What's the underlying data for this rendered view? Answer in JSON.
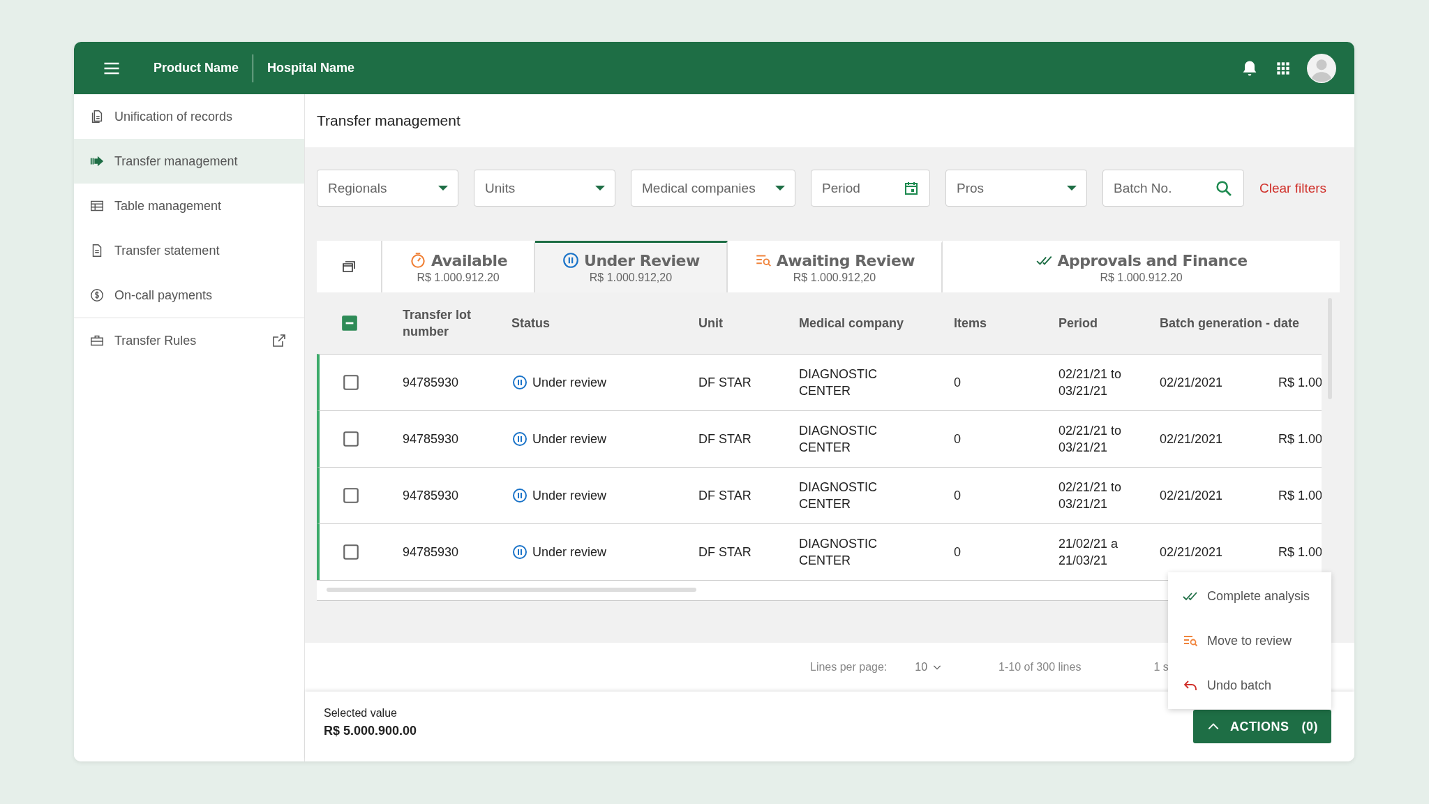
{
  "header": {
    "product": "Product Name",
    "hospital": "Hospital Name"
  },
  "sidebar": {
    "items": [
      {
        "label": "Unification of records",
        "kind": "documents",
        "selected": false
      },
      {
        "label": "Transfer management",
        "kind": "transfer",
        "selected": true
      },
      {
        "label": "Table management",
        "kind": "table",
        "selected": false
      },
      {
        "label": "Transfer statement",
        "kind": "document",
        "selected": false
      },
      {
        "label": "On-call payments",
        "kind": "money",
        "selected": false
      },
      {
        "label": "Transfer Rules",
        "kind": "briefcase",
        "selected": false,
        "external": true
      }
    ]
  },
  "page_title": "Transfer management",
  "filters": [
    {
      "kind": "dropdown",
      "placeholder": "Regionals"
    },
    {
      "kind": "dropdown",
      "placeholder": "Units"
    },
    {
      "kind": "dropdown",
      "placeholder": "Medical companies"
    },
    {
      "kind": "date",
      "placeholder": "Period"
    },
    {
      "kind": "dropdown",
      "placeholder": "Pros"
    },
    {
      "kind": "search",
      "placeholder": "Batch No."
    }
  ],
  "clear_filters": "Clear filters",
  "tabs": [
    {
      "label": "Available",
      "amount": "R$ 1.000.912.20",
      "kind": "timer",
      "selected": false
    },
    {
      "label": "Under Review",
      "amount": "R$ 1.000.912,20",
      "kind": "pause",
      "selected": true
    },
    {
      "label": "Awaiting Review",
      "amount": "R$ 1.000.912,20",
      "kind": "review",
      "selected": false
    },
    {
      "label": "Approvals and Finance",
      "amount": "R$ 1.000.912.20",
      "kind": "check",
      "selected": false
    }
  ],
  "table": {
    "select_all": {
      "indeterminate": true
    },
    "columns": [
      "Transfer lot number",
      "Status",
      "Unit",
      "Medical company",
      "Items",
      "Period",
      "Batch generation - date"
    ],
    "rows": [
      {
        "checked": false,
        "lot": "94785930",
        "status": "Under review",
        "unit": "DF STAR",
        "company": "DIAGNOSTIC CENTER",
        "items": "0",
        "period": "02/21/21 to 03/21/21",
        "date": "02/21/2021",
        "column_8": "R$ 1.00"
      },
      {
        "checked": false,
        "lot": "94785930",
        "status": "Under review",
        "unit": "DF STAR",
        "company": "DIAGNOSTIC CENTER",
        "items": "0",
        "period": "02/21/21 to 03/21/21",
        "date": "02/21/2021",
        "column_8": "R$ 1.00"
      },
      {
        "checked": false,
        "lot": "94785930",
        "status": "Under review",
        "unit": "DF STAR",
        "company": "DIAGNOSTIC CENTER",
        "items": "0",
        "period": "02/21/21 to 03/21/21",
        "date": "02/21/2021",
        "column_8": "R$ 1.00"
      },
      {
        "checked": false,
        "lot": "94785930",
        "status": "Under review",
        "unit": "DF STAR",
        "company": "DIAGNOSTIC CENTER",
        "items": "0",
        "period": "21/02/21 a 21/03/21",
        "date": "02/21/2021",
        "column_8": "R$ 1.00"
      }
    ]
  },
  "pagination": {
    "lines_label": "Lines per page:",
    "lines_value": "10",
    "range": "1-10 of 300 lines",
    "page": "1 s"
  },
  "footer": {
    "label": "Selected value",
    "value": "R$ 5.000.900.00"
  },
  "actions_menu": [
    {
      "label": "Complete analysis",
      "kind": "check"
    },
    {
      "label": "Move to review",
      "kind": "review"
    },
    {
      "label": "Undo batch",
      "kind": "undo"
    }
  ],
  "actions_button": {
    "label": "ACTIONS",
    "count": "(0)"
  }
}
